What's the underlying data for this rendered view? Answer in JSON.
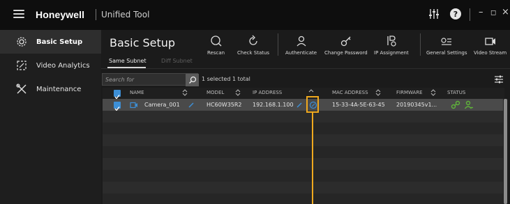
{
  "app": {
    "brand": "Honeywell",
    "name": "Unified Tool",
    "window_controls": {
      "minimize": "–",
      "maximize": "◻",
      "close": "×"
    },
    "icons": [
      "menu-icon",
      "equalizer-icon",
      "help-icon"
    ]
  },
  "sidebar": {
    "items": [
      {
        "label": "Basic Setup",
        "icon": "gear-icon",
        "active": true
      },
      {
        "label": "Video Analytics",
        "icon": "analytics-icon",
        "active": false
      },
      {
        "label": "Maintenance",
        "icon": "tools-icon",
        "active": false
      }
    ]
  },
  "main": {
    "title": "Basic Setup",
    "toolbar": {
      "rescan": "Rescan",
      "check_status": "Check Status",
      "authenticate": "Authenticate",
      "change_password": "Change Password",
      "ip_assignment": "IP Assignment",
      "general_settings": "General Settings",
      "video_stream": "Video Stream"
    },
    "tabs": [
      {
        "label": "Same Subnet",
        "active": true
      },
      {
        "label": "Diff Subnet",
        "active": false
      }
    ],
    "search": {
      "placeholder": "Search for",
      "value": ""
    },
    "selection_status": "1 selected  1 total",
    "table": {
      "columns": {
        "name": "NAME",
        "model": "MODEL",
        "ip": "IP ADDRESS",
        "mac": "MAC ADDRESS",
        "firmware": "FIRMWARE",
        "status": "STATUS"
      },
      "rows": [
        {
          "name": "Camera_001",
          "model": "HC60W35R2",
          "ip": "192.168.1.100",
          "mac": "15-33-4A-5E-63-45",
          "firmware": "20190345v1...",
          "selected": true
        }
      ]
    }
  },
  "colors": {
    "accent_blue": "#3d8fd6",
    "status_green": "#5fb33a",
    "highlight_orange": "#f0a91e",
    "background": "#1b1b1b"
  }
}
